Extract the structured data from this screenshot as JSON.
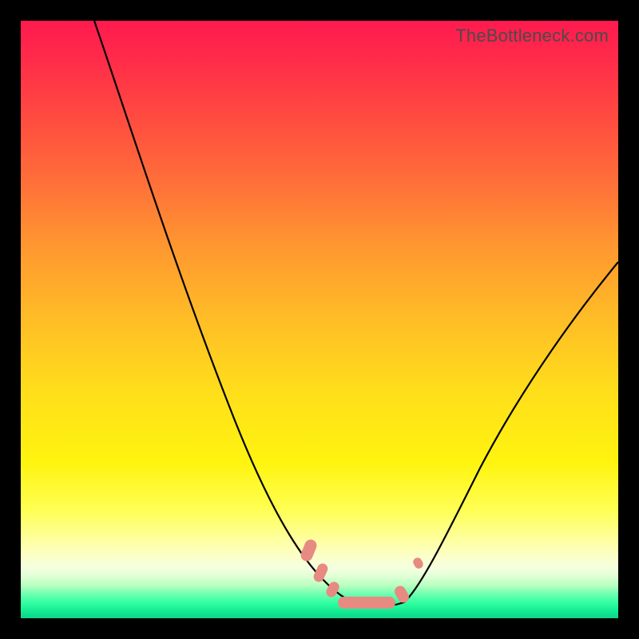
{
  "watermark": "TheBottleneck.com",
  "chart_data": {
    "type": "line",
    "title": "",
    "xlabel": "",
    "ylabel": "",
    "xlim": [
      0,
      100
    ],
    "ylim": [
      0,
      100
    ],
    "series": [
      {
        "name": "left-curve",
        "x": [
          12,
          15,
          18,
          21,
          24,
          27,
          30,
          33,
          36,
          39,
          42,
          45,
          48,
          50,
          53,
          56
        ],
        "y": [
          100,
          94,
          87,
          80,
          73,
          66,
          59,
          52,
          45,
          38,
          31,
          24,
          17,
          12,
          6,
          3
        ]
      },
      {
        "name": "right-curve",
        "x": [
          64,
          66,
          68,
          71,
          74,
          78,
          82,
          86,
          90,
          94,
          98,
          100
        ],
        "y": [
          3,
          6,
          10,
          16,
          22,
          30,
          37,
          43,
          49,
          54,
          58,
          60
        ]
      },
      {
        "name": "floor",
        "x": [
          56,
          58,
          60,
          62,
          64
        ],
        "y": [
          3,
          2,
          2,
          2,
          3
        ]
      }
    ],
    "annotations": [
      {
        "name": "marker-group",
        "approx_x_range": [
          48,
          66
        ],
        "approx_y_range": [
          2,
          13
        ],
        "color": "#e78a82"
      }
    ],
    "background_gradient": {
      "top": "#ff1a4f",
      "mid": "#ffde1b",
      "bottom": "#11e892"
    }
  }
}
